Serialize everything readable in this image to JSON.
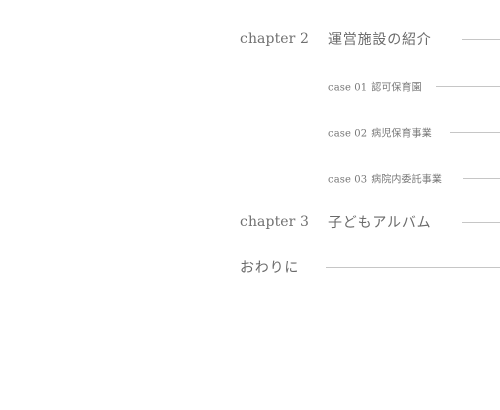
{
  "toc": {
    "chapter2": {
      "label": "chapter 2",
      "title": "運営施設の紹介"
    },
    "cases": [
      {
        "number": "case 01",
        "title": "認可保育園"
      },
      {
        "number": "case 02",
        "title": "病児保育事業"
      },
      {
        "number": "case 03",
        "title": "病院内委託事業"
      }
    ],
    "chapter3": {
      "label": "chapter 3",
      "title": "子どもアルバム"
    },
    "closing": {
      "title": "おわりに"
    }
  },
  "colors": {
    "text": "#6f6f6f",
    "rule": "#c6c6c6",
    "background": "#ffffff"
  }
}
